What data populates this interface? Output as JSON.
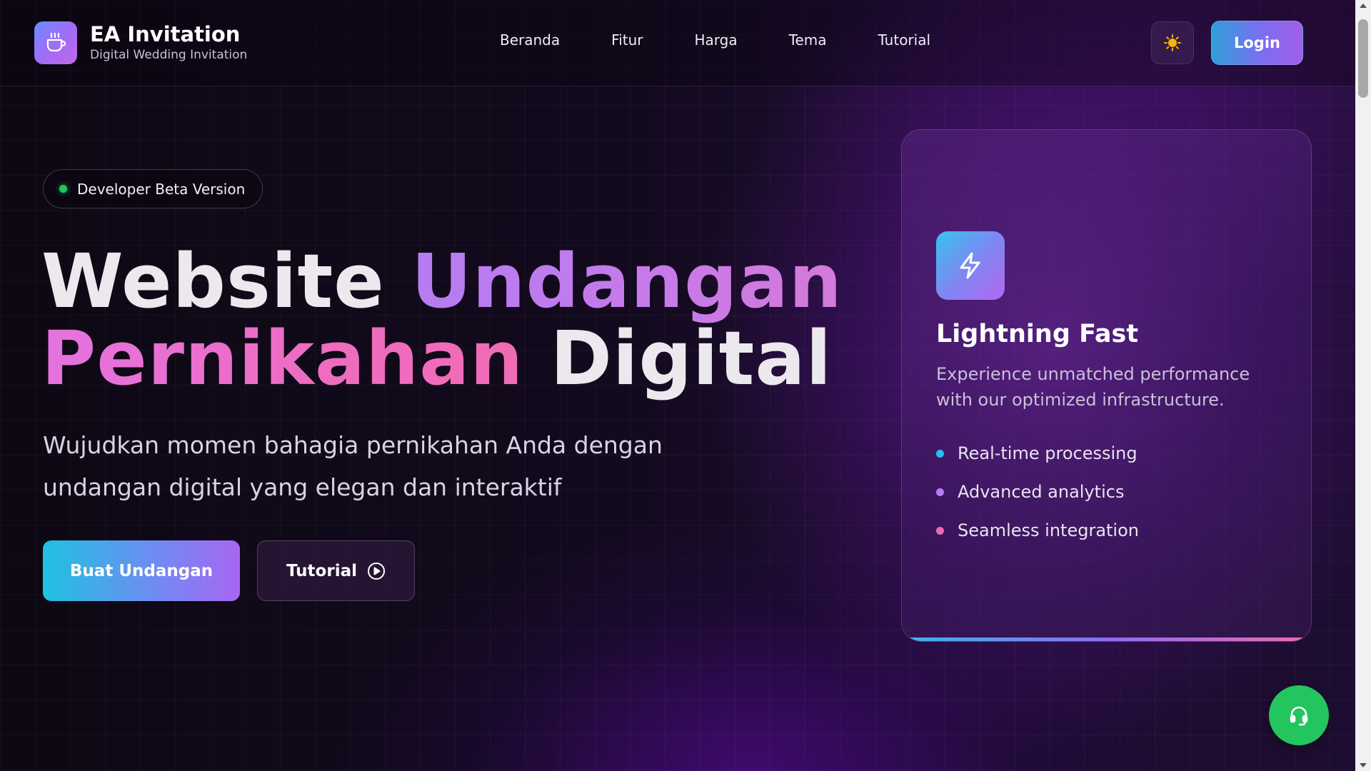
{
  "header": {
    "brand_name": "EA Invitation",
    "brand_tagline": "Digital Wedding Invitation",
    "nav": [
      "Beranda",
      "Fitur",
      "Harga",
      "Tema",
      "Tutorial"
    ],
    "login_label": "Login",
    "theme_icon": "sun-icon",
    "logo_icon": "coffee-cup-icon"
  },
  "hero": {
    "badge": "Developer Beta Version",
    "title_part1": "Website",
    "title_part2": "Undangan",
    "title_part3": "Pernikahan",
    "title_part4": "Digital",
    "subtitle_line1": "Wujudkan momen bahagia pernikahan Anda dengan",
    "subtitle_line2": "undangan digital yang elegan dan interaktif",
    "cta_primary": "Buat Undangan",
    "cta_secondary": "Tutorial"
  },
  "feature_card": {
    "icon": "lightning-icon",
    "title": "Lightning Fast",
    "description": "Experience unmatched performance with our optimized infrastructure.",
    "items": [
      {
        "label": "Real-time processing",
        "color": "#22c3ee"
      },
      {
        "label": "Advanced analytics",
        "color": "#b57cf3"
      },
      {
        "label": "Seamless integration",
        "color": "#f06bb0"
      }
    ]
  },
  "support": {
    "icon": "headset-icon"
  },
  "colors": {
    "accent_green": "#22c55e",
    "accent_cyan": "#22c3ee",
    "accent_purple": "#a866f2",
    "accent_pink": "#f06bb0"
  }
}
